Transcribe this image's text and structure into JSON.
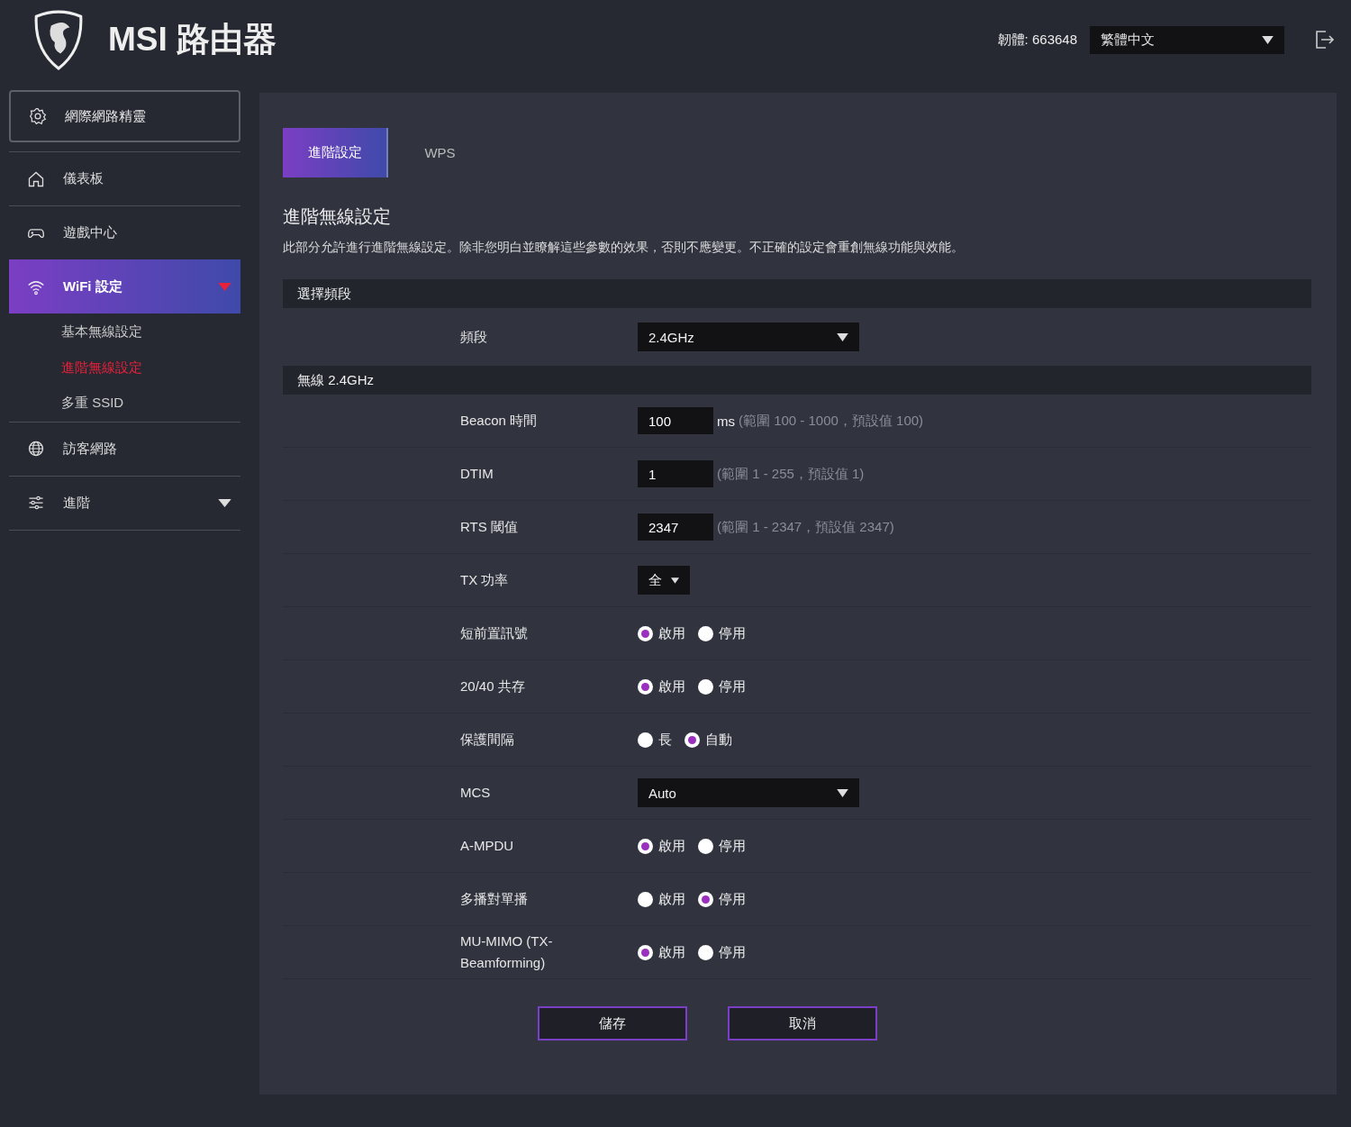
{
  "header": {
    "title": "MSI 路由器",
    "firmware": "韌體: 663648",
    "language": "繁體中文"
  },
  "sidebar": {
    "wizard": {
      "label": "網際網路精靈"
    },
    "items": [
      {
        "label": "儀表板",
        "kind": "link",
        "selected": false
      },
      {
        "label": "遊戲中心",
        "kind": "link",
        "selected": false
      },
      {
        "label": "WiFi 設定",
        "kind": "group",
        "selected": true,
        "children": [
          {
            "label": "基本無線設定",
            "selected": false
          },
          {
            "label": "進階無線設定",
            "selected": true
          },
          {
            "label": "多重 SSID",
            "selected": false
          }
        ]
      },
      {
        "label": "訪客網路",
        "kind": "link",
        "selected": false
      },
      {
        "label": "進階",
        "kind": "group",
        "selected": false
      }
    ]
  },
  "tabs": [
    {
      "label": "進階設定",
      "selected": true
    },
    {
      "label": "WPS",
      "selected": false
    }
  ],
  "heading": "進階無線設定",
  "description": "此部分允許進行進階無線設定。除非您明白並瞭解這些參數的效果，否則不應變更。不正確的設定會重創無線功能與效能。",
  "sections": [
    {
      "title": "選擇頻段",
      "rows": [
        {
          "label": "頻段",
          "kind": "select",
          "value": "2.4GHz"
        }
      ]
    },
    {
      "title": "無線 2.4GHz",
      "rows": [
        {
          "label": "Beacon 時間",
          "kind": "input",
          "value": "100",
          "unit": "ms",
          "hint": "(範圍 100 - 1000，預設值 100)"
        },
        {
          "label": "DTIM",
          "kind": "input",
          "value": "1",
          "hint": "(範圍 1 - 255，預設值 1)"
        },
        {
          "label": "RTS 閾值",
          "kind": "input",
          "value": "2347",
          "hint": "(範圍 1 - 2347，預設值 2347)"
        },
        {
          "label": "TX 功率",
          "kind": "small-select",
          "value": "全"
        },
        {
          "label": "短前置訊號",
          "kind": "radio",
          "options": [
            {
              "label": "啟用",
              "selected": true
            },
            {
              "label": "停用",
              "selected": false
            }
          ]
        },
        {
          "label": "20/40 共存",
          "kind": "radio",
          "options": [
            {
              "label": "啟用",
              "selected": true
            },
            {
              "label": "停用",
              "selected": false
            }
          ]
        },
        {
          "label": "保護間隔",
          "kind": "radio",
          "options": [
            {
              "label": "長",
              "selected": false
            },
            {
              "label": "自動",
              "selected": true
            }
          ]
        },
        {
          "label": "MCS",
          "kind": "select",
          "value": "Auto"
        },
        {
          "label": "A-MPDU",
          "kind": "radio",
          "options": [
            {
              "label": "啟用",
              "selected": true
            },
            {
              "label": "停用",
              "selected": false
            }
          ]
        },
        {
          "label": "多播對單播",
          "kind": "radio",
          "options": [
            {
              "label": "啟用",
              "selected": false
            },
            {
              "label": "停用",
              "selected": true
            }
          ]
        },
        {
          "label": "MU-MIMO (TX-Beamforming)",
          "kind": "radio",
          "options": [
            {
              "label": "啟用",
              "selected": true
            },
            {
              "label": "停用",
              "selected": false
            }
          ]
        }
      ]
    }
  ],
  "buttons": [
    "儲存",
    "取消"
  ]
}
